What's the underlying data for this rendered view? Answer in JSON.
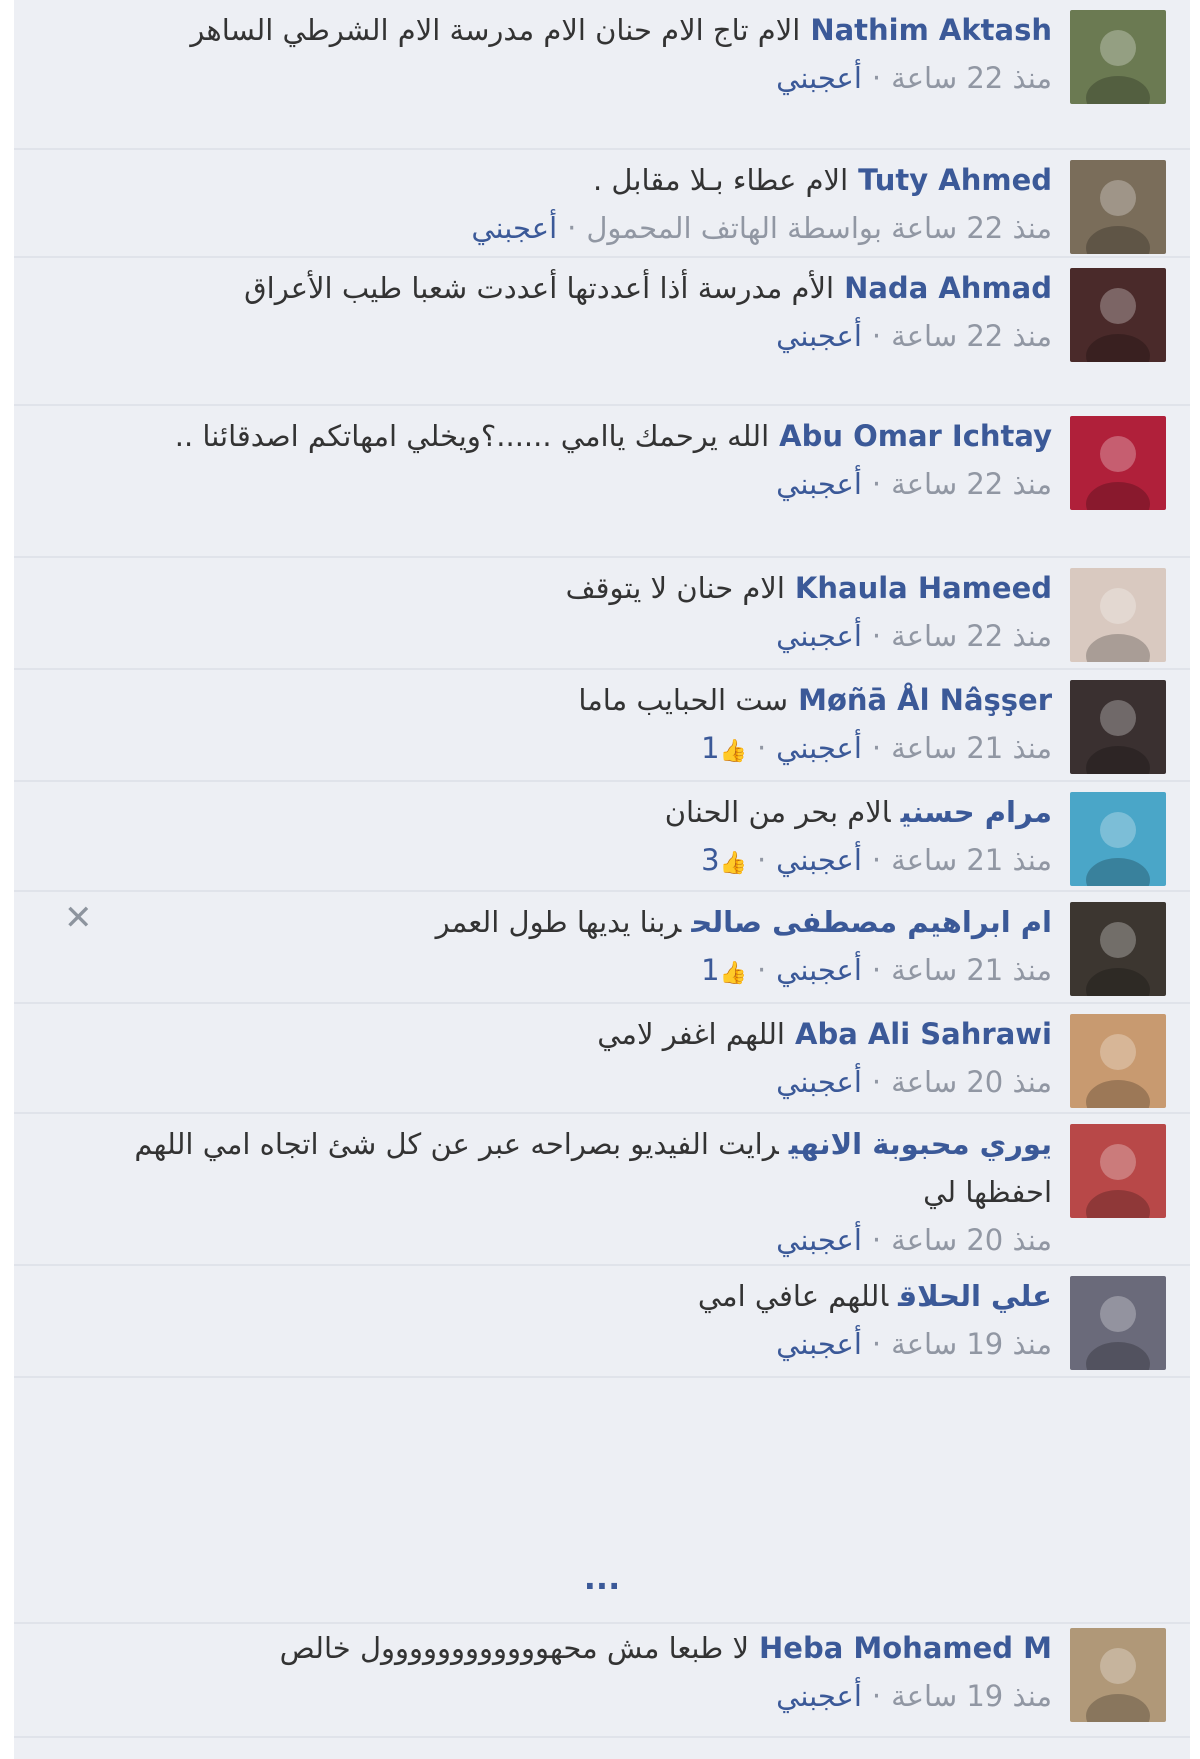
{
  "comments": [
    {
      "author": "Nathim Aktash",
      "text": "الام تاج الام حنان الام مدرسة الام الشرطي الساهر",
      "time": "منذ 22 ساعة",
      "like": "أعجبني",
      "likes": ""
    },
    {
      "author": "Tuty Ahmed",
      "text": "الام عطاء بـلا مقابل .",
      "time": "منذ 22 ساعة بواسطة الهاتف المحمول",
      "like": "أعجبني",
      "likes": ""
    },
    {
      "author": "Nada Ahmad",
      "text": "الأم مدرسة أذا أعددتها أعددت شعبا طيب الأعراق",
      "time": "منذ 22 ساعة",
      "like": "أعجبني",
      "likes": ""
    },
    {
      "author": "Abu Omar Ichtay",
      "text": "الله يرحمك ياامي ......؟ويخلي امهاتكم اصدقائنا ..",
      "time": "منذ 22 ساعة",
      "like": "أعجبني",
      "likes": ""
    },
    {
      "author": "Khaula Hameed",
      "text": "الام حنان لا يتوقف",
      "time": "منذ 22 ساعة",
      "like": "أعجبني",
      "likes": ""
    },
    {
      "author": "Møñā Ål Nâşşer",
      "text": "ست الحبايب ماما",
      "time": "منذ 21 ساعة",
      "like": "أعجبني",
      "likes": "1"
    },
    {
      "author": "مرام حسني",
      "text": "الام بحر من الحنان",
      "time": "منذ 21 ساعة",
      "like": "أعجبني",
      "likes": "3"
    },
    {
      "author": "ام ابراهيم مصطفى صالح",
      "text": "ربنا يديها طول العمر",
      "time": "منذ 21 ساعة",
      "like": "أعجبني",
      "likes": "1"
    },
    {
      "author": "Aba Ali Sahrawi",
      "text": "اللهم اغفر لامي",
      "time": "منذ 20 ساعة",
      "like": "أعجبني",
      "likes": ""
    },
    {
      "author": "يوري محبوبة الانهي",
      "text": "رايت الفيديو بصراحه عبر عن كل شئ اتجاه امي اللهم احفظها لي",
      "time": "منذ 20 ساعة",
      "like": "أعجبني",
      "likes": ""
    },
    {
      "author": "علي الحلاق",
      "text": "اللهم عافي امي",
      "time": "منذ 19 ساعة",
      "like": "أعجبني",
      "likes": ""
    },
    {
      "author": "Heba Mohamed M",
      "text": "لا طبعا مش محهوووووووووووول خالص",
      "time": "منذ 19 ساعة",
      "like": "أعجبني",
      "likes": ""
    }
  ],
  "more_label": "...",
  "close_glyph": "✕",
  "dot": "·",
  "like_glyph": "👍",
  "avatar_colors": [
    "#6b7a52",
    "#7a6d5a",
    "#4a2a2a",
    "#b0203a",
    "#d9c9c0",
    "#3a3030",
    "#4aa6c8",
    "#3c3630",
    "#c89a70",
    "#b84848",
    "#6a6a7a",
    "#b09878"
  ]
}
